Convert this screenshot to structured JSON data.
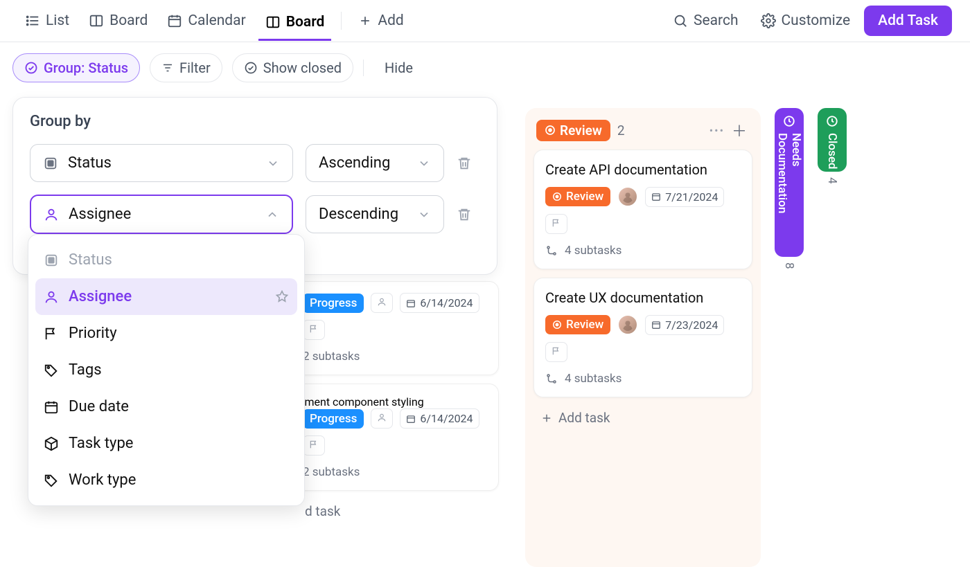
{
  "topbar": {
    "views": [
      {
        "icon": "list",
        "label": "List"
      },
      {
        "icon": "board",
        "label": "Board"
      },
      {
        "icon": "calendar",
        "label": "Calendar"
      },
      {
        "icon": "board",
        "label": "Board",
        "active": true
      }
    ],
    "add": "Add",
    "search": "Search",
    "customize": "Customize",
    "add_task": "Add Task"
  },
  "filterbar": {
    "group_status": "Group: Status",
    "filter": "Filter",
    "show_closed": "Show closed",
    "hide": "Hide"
  },
  "groupby_panel": {
    "title": "Group by",
    "rows": [
      {
        "field": "Status",
        "order": "Ascending"
      },
      {
        "field": "Assignee",
        "order": "Descending",
        "focused": true
      }
    ]
  },
  "dropdown": {
    "items": [
      {
        "icon": "status",
        "label": "Status",
        "disabled": true
      },
      {
        "icon": "user",
        "label": "Assignee",
        "selected": true
      },
      {
        "icon": "flag",
        "label": "Priority"
      },
      {
        "icon": "tag",
        "label": "Tags"
      },
      {
        "icon": "date",
        "label": "Due date"
      },
      {
        "icon": "cube",
        "label": "Task type"
      },
      {
        "icon": "tag",
        "label": "Work type"
      }
    ]
  },
  "board": {
    "in_progress_fragment": {
      "status_label": "Progress",
      "cards": [
        {
          "date": "6/14/2024",
          "subtasks": "2 subtasks"
        },
        {
          "title": "ement component styling",
          "date": "6/14/2024",
          "subtasks": "2 subtasks"
        }
      ],
      "add_task": "d task"
    },
    "review": {
      "status_label": "Review",
      "count": "2",
      "cards": [
        {
          "title": "Create API documentation",
          "status": "Review",
          "date": "7/21/2024",
          "subtasks": "4 subtasks"
        },
        {
          "title": "Create UX documentation",
          "status": "Review",
          "date": "7/23/2024",
          "subtasks": "4 subtasks"
        }
      ],
      "add_task": "Add task"
    },
    "needs_doc": {
      "label": "Needs Documentation",
      "count": "8"
    },
    "closed": {
      "label": "Closed",
      "count": "4"
    }
  }
}
